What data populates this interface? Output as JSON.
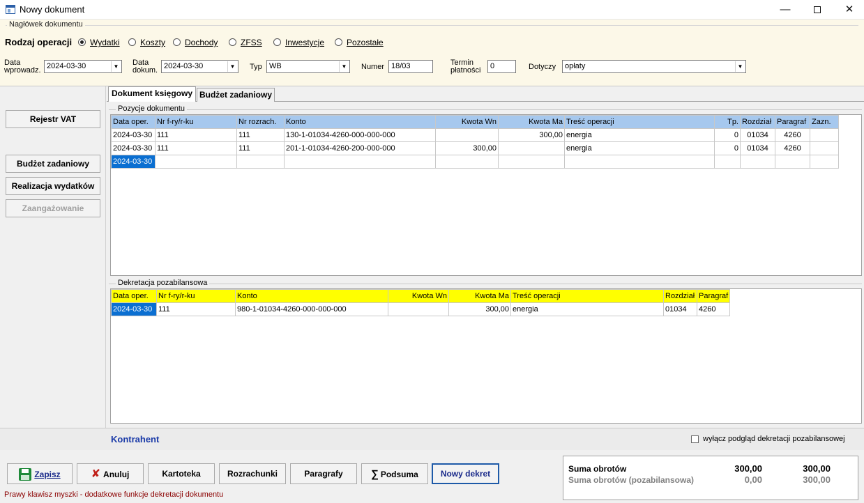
{
  "window": {
    "title": "Nowy dokument"
  },
  "header": {
    "group_title": "Nagłówek dokumentu",
    "operation_label": "Rodzaj operacji",
    "operation_options": [
      "Wydatki",
      "Koszty",
      "Dochody",
      "ZFSS",
      "Inwestycje",
      "Pozostałe"
    ],
    "selected_operation": "Wydatki",
    "data_wprowadz_label_1": "Data",
    "data_wprowadz_label_2": "wprowadz.",
    "data_wprowadz_value": "2024-03-30",
    "data_dokum_label_1": "Data",
    "data_dokum_label_2": "dokum.",
    "data_dokum_value": "2024-03-30",
    "typ_label": "Typ",
    "typ_value": "WB",
    "numer_label": "Numer",
    "numer_value": "18/03",
    "termin_label_1": "Termin",
    "termin_label_2": "płatności",
    "termin_value": "0",
    "dotyczy_label": "Dotyczy",
    "dotyczy_value": "opłaty"
  },
  "side_buttons": {
    "rejestr_vat": "Rejestr VAT",
    "budzet_zadaniowy": "Budżet zadaniowy",
    "realizacja_wydatkow": "Realizacja wydatków",
    "zaangazowanie": "Zaangażowanie"
  },
  "tabs": [
    "Dokument księgowy",
    "Budżet zadaniowy"
  ],
  "pozycje": {
    "title": "Pozycje dokumentu",
    "columns": [
      "Data oper.",
      "Nr f-ry/r-ku",
      "Nr rozrach.",
      "Konto",
      "Kwota Wn",
      "Kwota Ma",
      "Treść operacji",
      "Tp.",
      "Rozdział",
      "Paragraf",
      "Zazn."
    ],
    "rows": [
      [
        "2024-03-30",
        "111",
        "111",
        "130-1-01034-4260-000-000-000",
        "",
        "300,00",
        "energia",
        "0",
        "01034",
        "4260",
        ""
      ],
      [
        "2024-03-30",
        "111",
        "111",
        "201-1-01034-4260-200-000-000",
        "300,00",
        "",
        "energia",
        "0",
        "01034",
        "4260",
        ""
      ],
      [
        "2024-03-30",
        "",
        "",
        "",
        "",
        "",
        "",
        "",
        "",
        "",
        ""
      ]
    ]
  },
  "dekretacja": {
    "title": "Dekretacja pozabilansowa",
    "columns": [
      "Data oper.",
      "Nr f-ry/r-ku",
      "Konto",
      "Kwota Wn",
      "Kwota Ma",
      "Treść operacji",
      "Rozdział",
      "Paragraf"
    ],
    "rows": [
      [
        "2024-03-30",
        "111",
        "980-1-01034-4260-000-000-000",
        "",
        "300,00",
        "energia",
        "01034",
        "4260"
      ]
    ]
  },
  "bottom": {
    "kontrahent": "Kontrahent",
    "checkbox_label": "wyłącz podgląd dekretacji pozabilansowej",
    "buttons": {
      "zapisz": "Zapisz",
      "anuluj": "Anuluj",
      "kartoteka": "Kartoteka",
      "rozrachunki": "Rozrachunki",
      "paragrafy": "Paragrafy",
      "podsuma": "Podsuma",
      "nowy_dekret": "Nowy dekret"
    },
    "hint": "Prawy klawisz myszki - dodatkowe funkcje dekretacji dokumentu"
  },
  "summary": {
    "label_1": "Suma obrotów",
    "wn_1": "300,00",
    "ma_1": "300,00",
    "label_2": "Suma obrotów (pozabilansowa)",
    "wn_2": "0,00",
    "ma_2": "300,00"
  }
}
